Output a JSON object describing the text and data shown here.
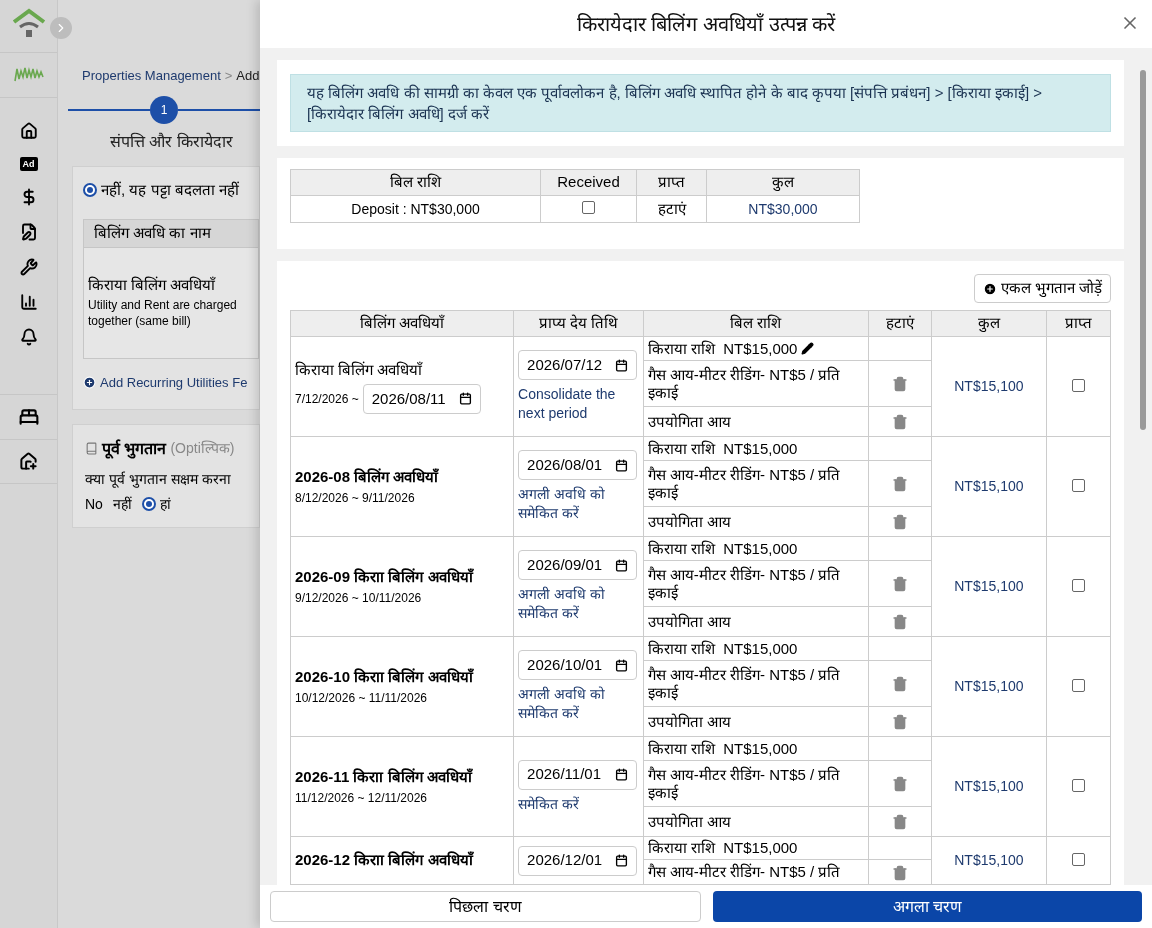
{
  "sidebar": {
    "ad_badge": "Ad"
  },
  "background_page": {
    "breadcrumb": {
      "link": "Properties Management",
      "separator": ">",
      "current": "Add"
    },
    "step": {
      "number": "1",
      "label": "संपत्ति और किरायेदार",
      "selected": true
    },
    "lease_option": {
      "label": "नहीं, यह पट्टा बदलता नहीं",
      "selected": true
    },
    "billing_table": {
      "column": "बिलिंग अवधि का नाम",
      "title": "किराया बिलिंग अवधियाँ",
      "note": "Utility and Rent are charged together (same bill)"
    },
    "add_link": "Add Recurring Utilities Fe",
    "prepayment": {
      "title": "पूर्व भुगतान",
      "optional": "(Optiल्पिक)",
      "question": "क्या पूर्व भुगतान सक्षम करना",
      "options": [
        {
          "label": "No",
          "selected": false
        },
        {
          "label": "नहीं",
          "selected": false
        },
        {
          "label": "हां",
          "selected": true
        }
      ]
    }
  },
  "modal": {
    "title": "किरायेदार बिलिंग अवधियाँ उत्पन्न करें",
    "notice": "यह बिलिंग अवधि की सामग्री का केवल एक पूर्वावलोकन है, बिलिंग अवधि स्थापित होने के बाद कृपया [संपत्ति प्रबंधन] > [किराया इकाई] > [किरायेदार बिलिंग अवधि] दर्ज करें",
    "deposit_table": {
      "columns": [
        "बिल राशि",
        "Received",
        "प्राप्त",
        "कुल"
      ],
      "row": {
        "bill": "Deposit : NT$30,000",
        "received": false,
        "action": "हटाएं",
        "total": "NT$30,000"
      }
    },
    "add_button": "एकल भुगतान जोड़ें",
    "periods_table": {
      "columns": [
        "बिलिंग अवधियाँ",
        "प्राप्य देय तिथि",
        "बिल राशि",
        "हटाएं",
        "कुल",
        "प्राप्त"
      ],
      "rows": [
        {
          "name": "किराया बिलिंग अवधियाँ",
          "range": "7/12/2026 ~",
          "end_date": "2026/08/11",
          "due_date": "2026/07/12",
          "consolidate": "Consolidate the next period",
          "items": [
            {
              "label": "किराया राशि  NT$15,000",
              "editable": true,
              "deletable": false
            },
            {
              "label": "गैस आय-मीटर रीडिंग- NT$5 / प्रति इकाई",
              "editable": false,
              "deletable": true
            },
            {
              "label": "उपयोगिता आय",
              "editable": false,
              "deletable": true
            }
          ],
          "total": "NT$15,100",
          "received": false
        },
        {
          "name": "2026-08 बिलिंग अवधियाँ",
          "range": "8/12/2026 ~ 9/11/2026",
          "due_date": "2026/08/01",
          "consolidate": "अगली अवधि को समेकित करें",
          "items": [
            {
              "label": "किराया राशि  NT$15,000",
              "editable": false,
              "deletable": false
            },
            {
              "label": "गैस आय-मीटर रीडिंग- NT$5 / प्रति इकाई",
              "editable": false,
              "deletable": true
            },
            {
              "label": "उपयोगिता आय",
              "editable": false,
              "deletable": true
            }
          ],
          "total": "NT$15,100",
          "received": false
        },
        {
          "name": "2026-09 किराा बिलिंग अवधियाँ",
          "range": "9/12/2026 ~ 10/11/2026",
          "due_date": "2026/09/01",
          "consolidate": "अगली अवधि को समेकित करें",
          "items": [
            {
              "label": "किराया राशि  NT$15,000",
              "editable": false,
              "deletable": false
            },
            {
              "label": "गैस आय-मीटर रीडिंग- NT$5 / प्रति इकाई",
              "editable": false,
              "deletable": true
            },
            {
              "label": "उपयोगिता आय",
              "editable": false,
              "deletable": true
            }
          ],
          "total": "NT$15,100",
          "received": false
        },
        {
          "name": "2026-10 किराा बिलिंग अवधियाँ",
          "range": "10/12/2026 ~ 11/11/2026",
          "due_date": "2026/10/01",
          "consolidate": "अगली अवधि को समेकित करें",
          "items": [
            {
              "label": "किराया राशि  NT$15,000",
              "editable": false,
              "deletable": false
            },
            {
              "label": "गैस आय-मीटर रीडिंग- NT$5 / प्रति इकाई",
              "editable": false,
              "deletable": true
            },
            {
              "label": "उपयोगिता आय",
              "editable": false,
              "deletable": true
            }
          ],
          "total": "NT$15,100",
          "received": false
        },
        {
          "name": "2026-11 किराा बिलिंग अवधियाँ",
          "range": "11/12/2026 ~ 12/11/2026",
          "due_date": "2026/11/01",
          "consolidate": "समेकित करें",
          "items": [
            {
              "label": "किराया राशि  NT$15,000",
              "editable": false,
              "deletable": false
            },
            {
              "label": "गैस आय-मीटर रीडिंग- NT$5 / प्रति इकाई",
              "editable": false,
              "deletable": true
            },
            {
              "label": "उपयोगिता आय",
              "editable": false,
              "deletable": true
            }
          ],
          "total": "NT$15,100",
          "received": false
        },
        {
          "name": "2026-12 किराा बिलिंग अवधियाँ",
          "due_date": "2026/12/01",
          "items": [
            {
              "label": "किराया राशि  NT$15,000",
              "editable": false,
              "deletable": false
            },
            {
              "label": "गैस आय-मीटर रीडिंग- NT$5 / प्रति",
              "editable": false,
              "deletable": true
            }
          ],
          "total": "NT$15,100",
          "received": false
        }
      ]
    },
    "buttons": {
      "previous": "पिछला चरण",
      "next": "अगला चरण"
    }
  }
}
